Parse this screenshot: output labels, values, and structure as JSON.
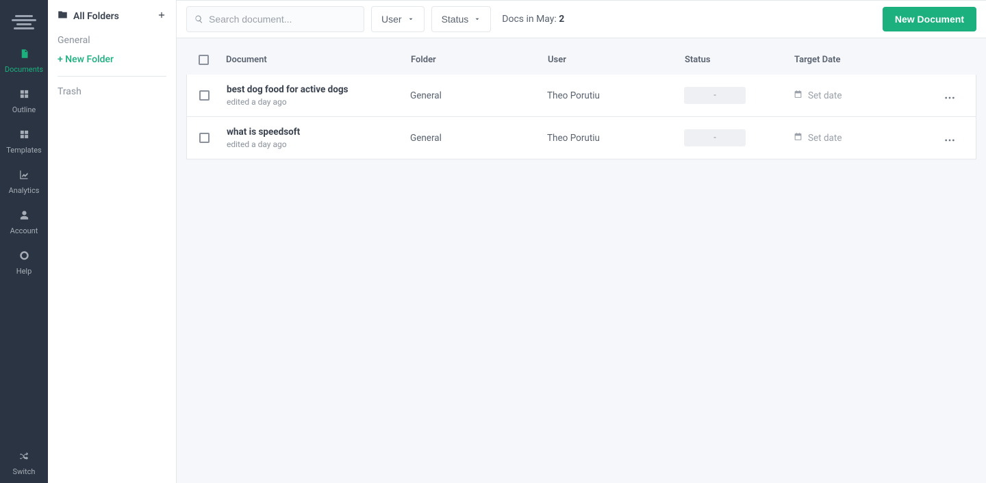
{
  "nav": {
    "items": [
      {
        "id": "documents",
        "label": "Documents",
        "active": true
      },
      {
        "id": "outline",
        "label": "Outline",
        "active": false
      },
      {
        "id": "templates",
        "label": "Templates",
        "active": false
      },
      {
        "id": "analytics",
        "label": "Analytics",
        "active": false
      },
      {
        "id": "account",
        "label": "Account",
        "active": false
      },
      {
        "id": "help",
        "label": "Help",
        "active": false
      }
    ],
    "switch_label": "Switch"
  },
  "sidebar": {
    "title": "All Folders",
    "folders": [
      {
        "name": "General"
      }
    ],
    "new_folder_label": "+ New Folder",
    "trash_label": "Trash"
  },
  "toolbar": {
    "search_placeholder": "Search document...",
    "filters": {
      "user_label": "User",
      "status_label": "Status"
    },
    "docs_count_label": "Docs in May: ",
    "docs_count_value": "2",
    "new_document_label": "New Document"
  },
  "table": {
    "headers": {
      "document": "Document",
      "folder": "Folder",
      "user": "User",
      "status": "Status",
      "target_date": "Target Date"
    },
    "rows": [
      {
        "title": "best dog food for active dogs",
        "subtitle": "edited a day ago",
        "folder": "General",
        "user": "Theo Porutiu",
        "status": "-",
        "target_date": "Set date"
      },
      {
        "title": "what is speedsoft",
        "subtitle": "edited a day ago",
        "folder": "General",
        "user": "Theo Porutiu",
        "status": "-",
        "target_date": "Set date"
      }
    ]
  }
}
